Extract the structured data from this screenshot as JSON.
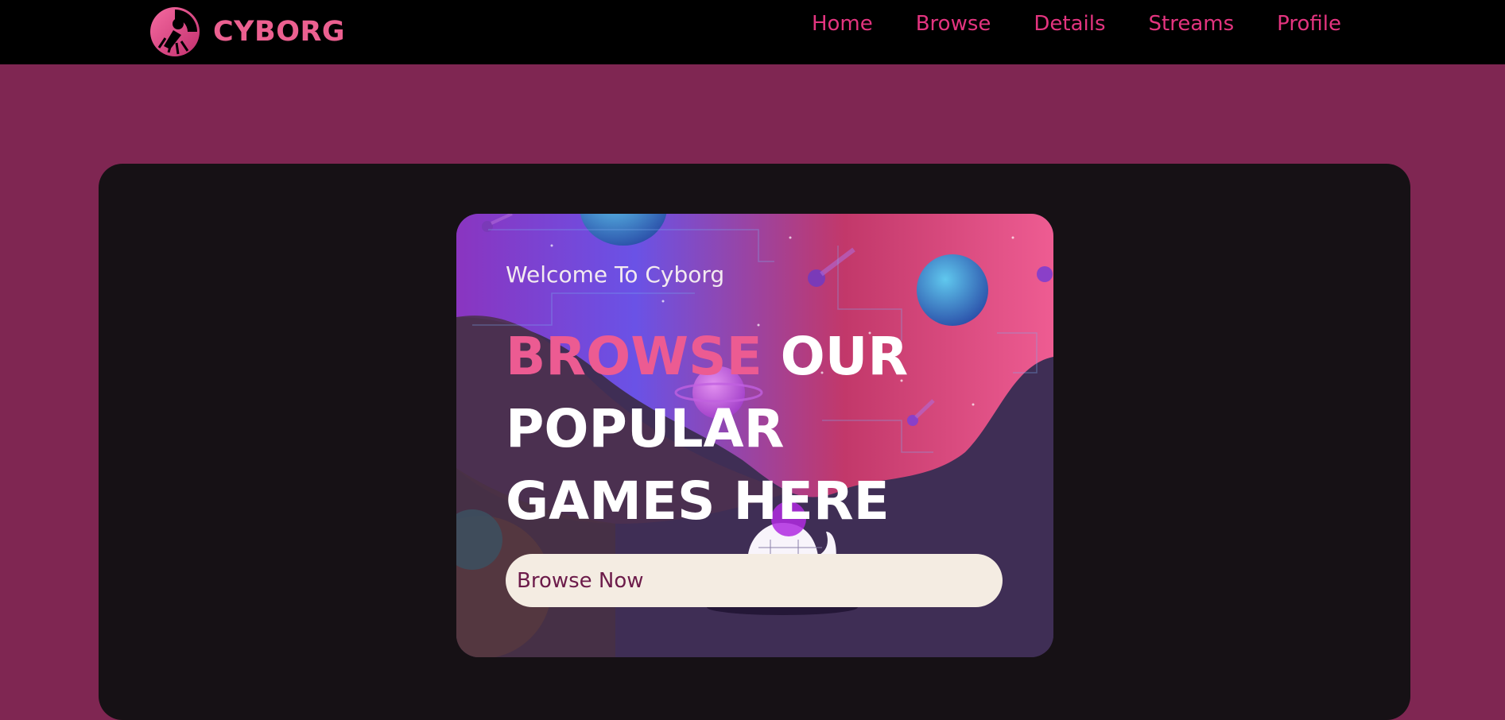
{
  "brand": {
    "name": "CYBORG",
    "color": "#ec6090"
  },
  "nav": {
    "items": [
      {
        "label": "Home"
      },
      {
        "label": "Browse"
      },
      {
        "label": "Details"
      },
      {
        "label": "Streams"
      },
      {
        "label": "Profile"
      }
    ],
    "link_color": "#e3347f"
  },
  "hero": {
    "welcome": "Welcome To Cyborg",
    "headline_accent": "BROWSE",
    "headline_rest_line1": "OUR",
    "headline_line2": "POPULAR",
    "headline_line3": "GAMES HERE",
    "button_label": "Browse Now",
    "illustration": "space-planets-astronaut-illustration"
  },
  "colors": {
    "page_background": "#7f2652",
    "topbar": "#000000",
    "frame": "#161115",
    "accent": "#ec5b92",
    "button_bg": "#f4ece2",
    "button_text": "#6c1b4a"
  },
  "icons": {
    "logo": "cyborg-logo-icon"
  }
}
